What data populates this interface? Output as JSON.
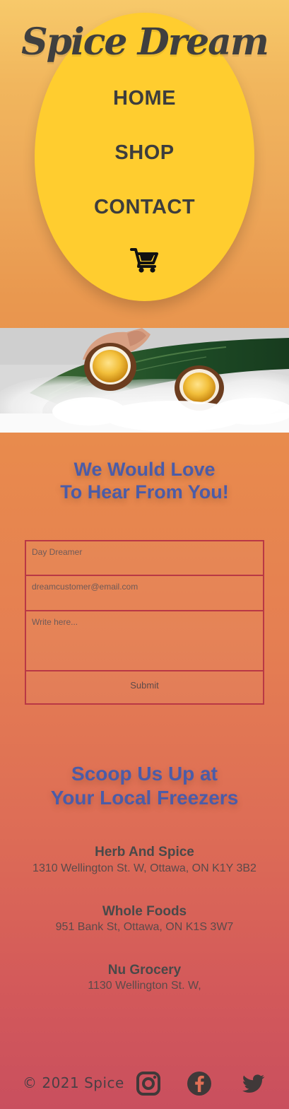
{
  "brand": "Spice Dream",
  "nav": {
    "home": "HOME",
    "shop": "SHOP",
    "contact": "CONTACT",
    "cart_icon": "shopping-cart-icon"
  },
  "hero": {
    "description": ""
  },
  "contact": {
    "title_line1": "We Would Love",
    "title_line2": "To Hear From You!",
    "name_placeholder": "Day Dreamer",
    "email_placeholder": "dreamcustomer@email.com",
    "message_placeholder": "Write here...",
    "submit_label": "Submit"
  },
  "stores": {
    "title_line1": "Scoop Us Up at",
    "title_line2": "Your Local Freezers",
    "items": [
      {
        "name": "Herb And Spice",
        "address": "1310 Wellington St. W, Ottawa, ON K1Y 3B2"
      },
      {
        "name": "Whole Foods",
        "address": "951 Bank St, Ottawa, ON K1S 3W7"
      },
      {
        "name": "Nu Grocery",
        "address": "1130 Wellington St. W,"
      }
    ]
  },
  "footer": {
    "copyright": "© 2021 Spice",
    "instagram_icon": "instagram-icon",
    "facebook_icon": "facebook-icon",
    "twitter_icon": "twitter-icon"
  },
  "colors": {
    "accent_yellow": "#ffcd2f",
    "accent_blue": "#4b5ca8",
    "form_border": "#b93845",
    "dark_text": "#3d3d3d"
  }
}
